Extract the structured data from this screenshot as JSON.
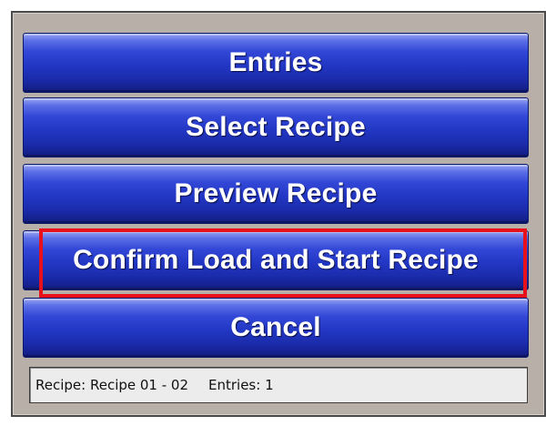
{
  "menu": {
    "buttons": [
      {
        "label": "Entries"
      },
      {
        "label": "Select Recipe"
      },
      {
        "label": "Preview Recipe"
      },
      {
        "label": "Confirm Load and Start Recipe",
        "highlighted": true
      },
      {
        "label": "Cancel"
      }
    ]
  },
  "status": {
    "recipe": "Recipe: Recipe 01 - 02",
    "entries": "Entries: 1"
  },
  "colors": {
    "button_blue": "#2236c4",
    "highlight_red": "#e8101a",
    "panel_gray": "#b8b0a8"
  }
}
